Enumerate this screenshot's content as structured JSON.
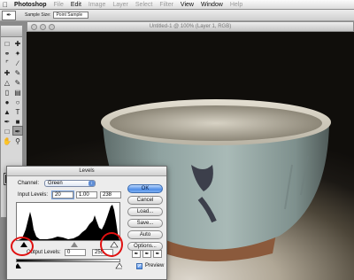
{
  "menubar": {
    "apple": "",
    "items": [
      {
        "label": "Photoshop",
        "bold": true,
        "enabled": true
      },
      {
        "label": "File",
        "enabled": false
      },
      {
        "label": "Edit",
        "enabled": true
      },
      {
        "label": "Image",
        "enabled": false
      },
      {
        "label": "Layer",
        "enabled": false
      },
      {
        "label": "Select",
        "enabled": false
      },
      {
        "label": "Filter",
        "enabled": false
      },
      {
        "label": "View",
        "enabled": true
      },
      {
        "label": "Window",
        "enabled": true
      },
      {
        "label": "Help",
        "enabled": false
      }
    ]
  },
  "options": {
    "tool_preset_icon": "eyedropper-icon",
    "sample_size_label": "Sample Size:",
    "sample_size_value": "Point Sample"
  },
  "document": {
    "title": "Untitled-1 @ 100% (Layer 1, RGB)"
  },
  "levels": {
    "title": "Levels",
    "channel_label": "Channel:",
    "channel_value": "Green",
    "input_levels_label": "Input Levels:",
    "input_black": "20",
    "input_gamma": "1.00",
    "input_white": "238",
    "output_levels_label": "Output Levels:",
    "output_black": "0",
    "output_white": "255",
    "buttons": {
      "ok": "OK",
      "cancel": "Cancel",
      "load": "Load...",
      "save": "Save...",
      "auto": "Auto",
      "options": "Options..."
    },
    "preview_label": "Preview",
    "preview_checked": true
  },
  "colors": {
    "annotation_red": "#e01010",
    "default_button_blue": "#4f8ee8"
  }
}
